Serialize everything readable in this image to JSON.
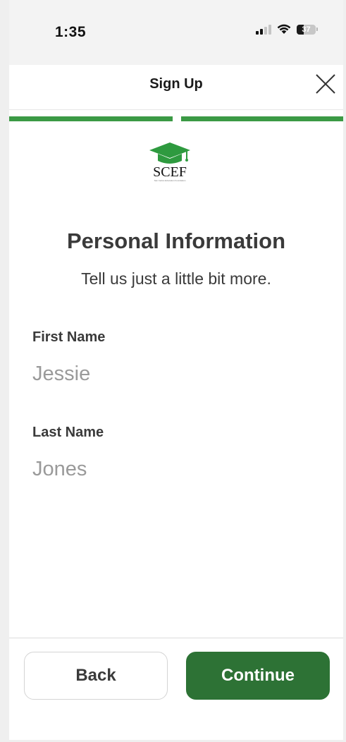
{
  "status_bar": {
    "time": "1:35",
    "battery": "37",
    "battery_level": 0.37
  },
  "nav": {
    "title": "Sign Up",
    "close_icon": "close-icon"
  },
  "progress": {
    "steps_total": 2,
    "steps_completed": 2,
    "color": "#3b9a45"
  },
  "logo": {
    "text": "SCEF",
    "subtext": "San Carlos Education Foundation",
    "icon": "graduation-cap-icon",
    "color": "#2e9a3f"
  },
  "page": {
    "title": "Personal Information",
    "subtitle": "Tell us just a little bit more."
  },
  "form": {
    "first_name_label": "First Name",
    "first_name_placeholder": "Jessie",
    "last_name_label": "Last Name",
    "last_name_placeholder": "Jones"
  },
  "footer": {
    "back_label": "Back",
    "continue_label": "Continue",
    "accent": "#2d7235"
  }
}
